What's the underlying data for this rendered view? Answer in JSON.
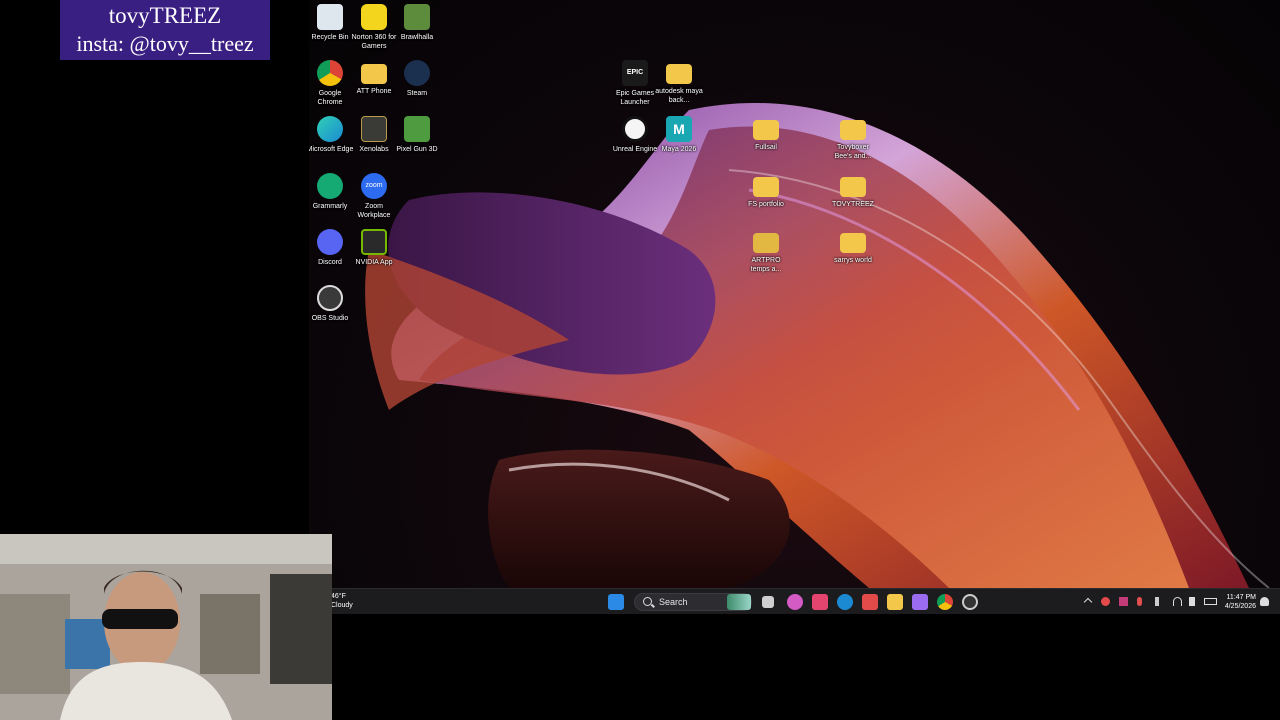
{
  "banner": {
    "line1": "tovyTREEZ",
    "line2": "insta: @tovy__treez"
  },
  "desktop": {
    "icons": [
      {
        "label": "Recycle Bin",
        "icon": "recycle-bin-icon",
        "color": "#dfe7ee"
      },
      {
        "label": "Norton 360 for Gamers",
        "icon": "norton-icon",
        "color": "#f2d51c"
      },
      {
        "label": "Brawlhalla",
        "icon": "brawlhalla-icon",
        "color": "#5c8c3c"
      },
      {
        "label": "Google Chrome",
        "icon": "chrome-icon",
        "color": "#2f8b45"
      },
      {
        "label": "ATT Phone",
        "icon": "folder-icon",
        "color": "#f3c84a"
      },
      {
        "label": "Steam",
        "icon": "steam-icon",
        "color": "#1b2f4e"
      },
      {
        "label": "Microsoft Edge",
        "icon": "edge-icon",
        "color": "#1c8ad3"
      },
      {
        "label": "Xenolabs",
        "icon": "xenolabs-icon",
        "color": "#3a3a36"
      },
      {
        "label": "Pixel Gun 3D",
        "icon": "pixel-gun-icon",
        "color": "#4f9b3f"
      },
      {
        "label": "Grammarly",
        "icon": "grammarly-icon",
        "color": "#15a974"
      },
      {
        "label": "Zoom Workplace",
        "icon": "zoom-icon",
        "color": "#2d6bf0",
        "text": "zoom"
      },
      {
        "label": "Discord",
        "icon": "discord-icon",
        "color": "#5865f2"
      },
      {
        "label": "NVIDIA App",
        "icon": "nvidia-icon",
        "color": "#2a2a2a"
      },
      {
        "label": "OBS Studio",
        "icon": "obs-icon",
        "color": "#3a3a3a"
      },
      {
        "label": "Epic Games Launcher",
        "icon": "epic-games-icon",
        "color": "#1a1a1a",
        "text": "EPIC"
      },
      {
        "label": "autodesk maya back...",
        "icon": "folder-icon",
        "color": "#f3c84a"
      },
      {
        "label": "Unreal Engine",
        "icon": "unreal-engine-icon",
        "color": "#f5f5f5"
      },
      {
        "label": "Maya 2026",
        "icon": "maya-icon",
        "color": "#1aa7b4",
        "text": "M"
      },
      {
        "label": "Fullsail",
        "icon": "folder-icon",
        "color": "#f3c84a"
      },
      {
        "label": "Tovyboxer Bee's and...",
        "icon": "folder-icon",
        "color": "#f3c84a"
      },
      {
        "label": "FS portfolio",
        "icon": "folder-icon",
        "color": "#f3c84a"
      },
      {
        "label": "TOVYTREEZ",
        "icon": "folder-icon",
        "color": "#f3c84a"
      },
      {
        "label": "ARTPRO temps a...",
        "icon": "folder-icon",
        "color": "#e2b843"
      },
      {
        "label": "sarrys world",
        "icon": "folder-icon",
        "color": "#f3c84a"
      }
    ]
  },
  "taskbar": {
    "weather_temp": "46°F",
    "weather_desc": "Cloudy",
    "search_placeholder": "Search",
    "time": "11:47 PM",
    "date": "4/25/2026",
    "pinned": [
      {
        "name": "task-view-icon",
        "color": "#cfcfcf"
      },
      {
        "name": "copilot-icon",
        "color": "#d45ac4"
      },
      {
        "name": "instagram-icon",
        "color": "#e3456f"
      },
      {
        "name": "edge-icon",
        "color": "#1c8ad3"
      },
      {
        "name": "snipping-tool-icon",
        "color": "#e34a4a"
      },
      {
        "name": "file-explorer-icon",
        "color": "#f3c84a"
      },
      {
        "name": "pen-tool-icon",
        "color": "#9b6cf0"
      },
      {
        "name": "chrome-icon",
        "color": "#2f8b45"
      },
      {
        "name": "obs-icon",
        "color": "#cccccc"
      }
    ]
  }
}
